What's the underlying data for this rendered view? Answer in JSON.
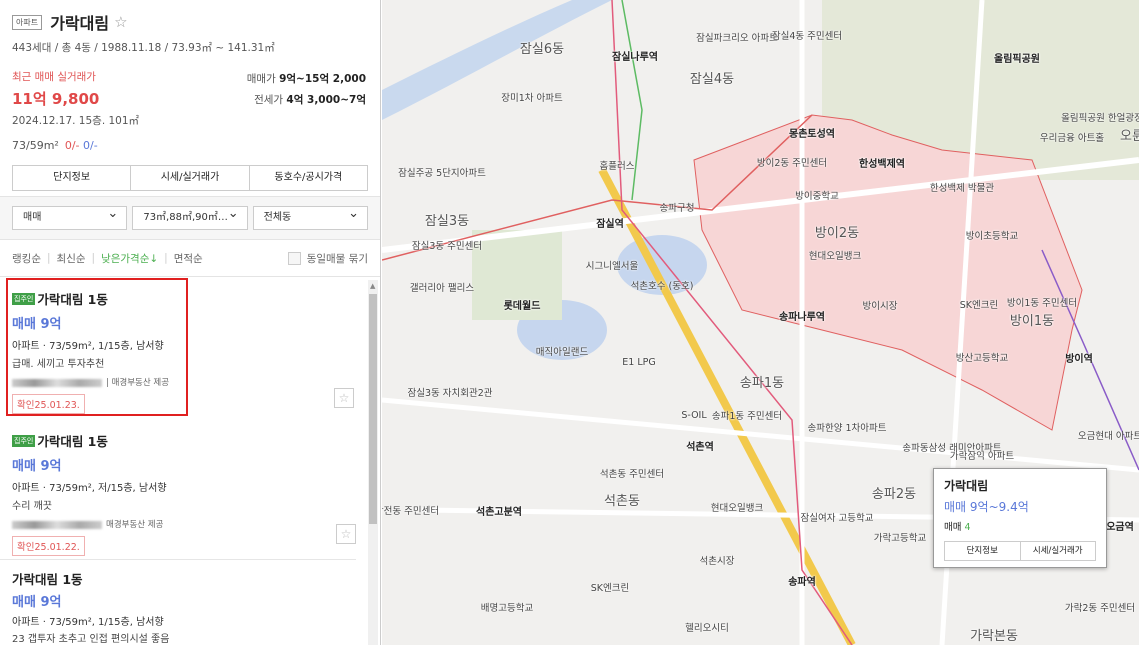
{
  "complex": {
    "type": "아파트",
    "name": "가락대림",
    "info": "443세대 / 총 4동 / 1988.11.18 / 73.93㎡ ~ 141.31㎡",
    "recent_label": "최근 매매 실거래가",
    "recent_price": "11억 9,800",
    "recent_detail": "2024.12.17. 15층. 101㎡",
    "sale_label": "매매가",
    "sale_range": "9억~15억 2,000",
    "jeonse_label": "전세가",
    "jeonse_range": "4억 3,000~7억",
    "area": "73/59m²",
    "count_red": "0/-",
    "count_blue": "0/-",
    "tabs": [
      "단지정보",
      "시세/실거래가",
      "동호수/공시가격"
    ]
  },
  "filters": {
    "trade": "매매",
    "area": "73㎡,88㎡,90㎡…",
    "dong": "전체동"
  },
  "sort": {
    "options": [
      "랭킹순",
      "최신순",
      "낮은가격순↓",
      "면적순"
    ],
    "group_label": "동일매물 묶기"
  },
  "listings": [
    {
      "tag": "집주인",
      "name": "가락대림 1동",
      "price": "매매 9억",
      "desc": "아파트 · 73/59m², 1/15층, 남서향",
      "note": "급매. 세끼고 투자추천",
      "agent": "매경부동산 제공",
      "confirmed": "확인25.01.23."
    },
    {
      "tag": "집주인",
      "name": "가락대림 1동",
      "price": "매매 9억",
      "desc": "아파트 · 73/59m², 저/15층, 남서향",
      "note": "수리 깨끗",
      "agent": "매경부동산 제공",
      "confirmed": "확인25.01.22."
    },
    {
      "name": "가락대림 1동",
      "price": "매매 9억",
      "desc": "아파트 · 73/59m², 1/15층, 남서향",
      "note": "23 갭투자 초추고 인접 편의시설 좋음"
    }
  ],
  "popup": {
    "name": "가락대림",
    "price": "매매 9억~9.4억",
    "count_label": "매매",
    "count": "4",
    "buttons": [
      "단지정보",
      "시세/실거래가"
    ]
  },
  "map": {
    "labels": [
      "잠실6동",
      "잠실나루역",
      "잠실파크리오 아파트",
      "잠실4동 주민센터",
      "잠실4동",
      "올림픽공원",
      "몽촌토성역",
      "한성백제역",
      "방이2동 주민센터",
      "방이중학교",
      "한성백제 박물관",
      "우리금융 아트홀",
      "올림픽공원 한얼광장",
      "잠실주공 5단지아파트",
      "홈플러스",
      "잠실3동",
      "잠실역",
      "송파구청",
      "잠실3동 주민센터",
      "시그니엘서울",
      "방이2동",
      "현대오일뱅크",
      "방이초등학교",
      "갤러리아 팰리스",
      "롯데월드",
      "석촌호수 (동호)",
      "방이시장",
      "송파나루역",
      "SK엔크린",
      "방이1동 주민센터",
      "방이1동",
      "매직아일랜드",
      "E1 LPG",
      "송파1동",
      "방산고등학교",
      "방이역",
      "잠실3동 자치회관2관",
      "S-OIL",
      "송파1동 주민센터",
      "석촌역",
      "송파한양 1차아파트",
      "오금현대 아파트",
      "송파2동",
      "가락삼익 아파트",
      "삼전동 주민센터",
      "석촌고분역",
      "석촌동",
      "석촌동 주민센터",
      "현대오일뱅크",
      "잠실여자 고등학교",
      "가락고등학교",
      "석촌시장",
      "송파역",
      "SK엔크린",
      "배명고등학교",
      "헬리오시티",
      "가락본동",
      "가락2동 주민센터",
      "오금역",
      "송파동삼성 래미안아파트",
      "장미1차 아파트",
      "오륜"
    ]
  }
}
